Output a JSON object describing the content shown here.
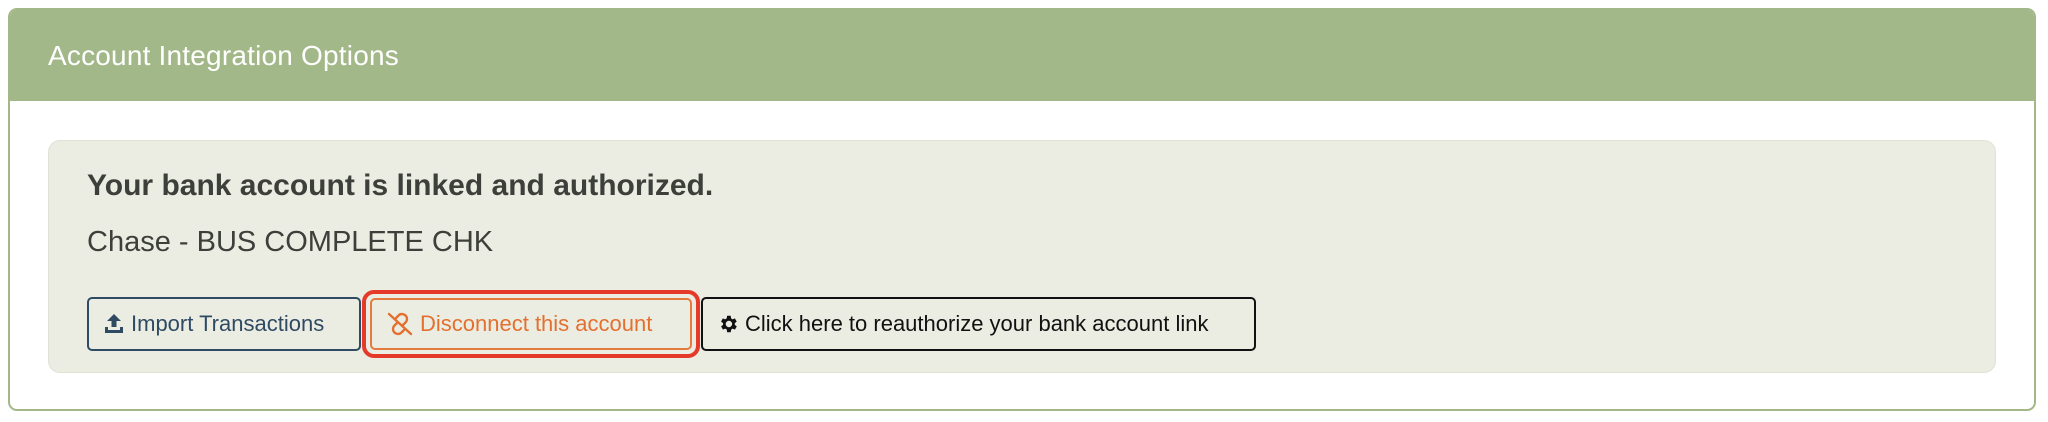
{
  "card": {
    "title": "Account Integration Options"
  },
  "status": {
    "heading": "Your bank account is linked and authorized.",
    "account_name": "Chase - BUS COMPLETE CHK"
  },
  "actions": {
    "import_label": "Import Transactions",
    "import_icon": "upload-icon",
    "disconnect_label": "Disconnect this account",
    "disconnect_icon": "unlink-icon",
    "reauthorize_label": "Click here to reauthorize your bank account link",
    "reauthorize_icon": "gear-icon"
  },
  "colors": {
    "header_bg": "#a3b888",
    "panel_bg": "#ebede3",
    "import_color": "#2f4b63",
    "disconnect_color": "#e4702f",
    "highlight_ring": "#e53a2a"
  }
}
